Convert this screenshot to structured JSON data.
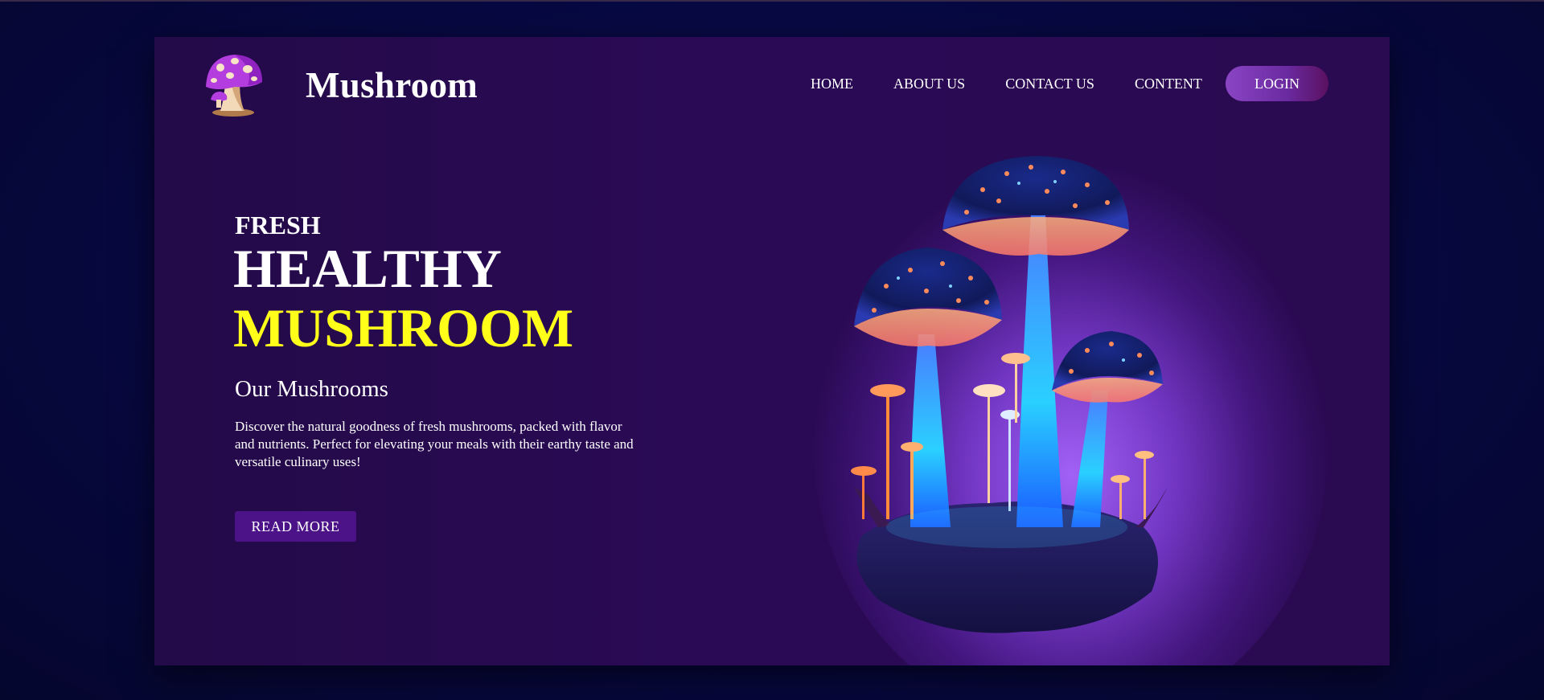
{
  "header": {
    "brand": "Mushroom",
    "nav": [
      "HOME",
      "ABOUT US",
      "CONTACT US",
      "CONTENT"
    ],
    "login_label": "LOGIN"
  },
  "hero": {
    "kicker": "FRESH",
    "title_line1": "HEALTHY",
    "title_line2": "MUSHROOM",
    "subheading": "Our Mushrooms",
    "description": "Discover the natural goodness of fresh mushrooms, packed with flavor and nutrients. Perfect for elevating your meals with their earthy taste and versatile culinary uses!",
    "cta_label": "READ MORE"
  },
  "colors": {
    "accent_yellow": "#ffff1a",
    "button_purple": "#4c1288",
    "card_bg": "#2a0a55",
    "page_bg": "#07083a"
  },
  "icons": {
    "logo": "mushroom-logo-icon",
    "hero_image": "glowing-mushrooms-illustration"
  }
}
